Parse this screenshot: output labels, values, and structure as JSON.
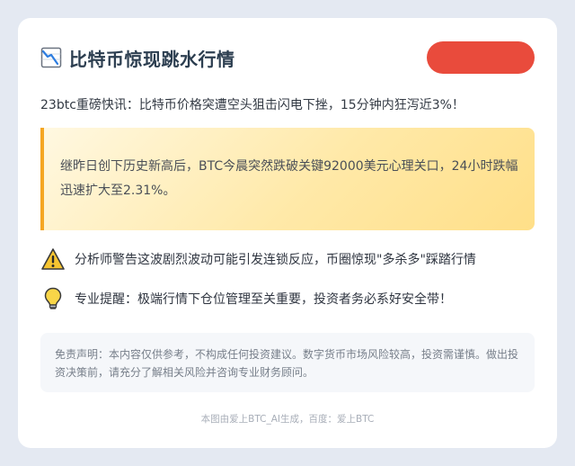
{
  "header": {
    "title": "比特币惊现跳水行情",
    "title_icon": "chart-down-icon",
    "badge_color": "#e94b3c"
  },
  "subtitle": "23btc重磅快讯：比特币价格突遭空头狙击闪电下挫，15分钟内狂泻近3%！",
  "highlight": {
    "text": "继昨日创下历史新高后，BTC今晨突然跌破关键92000美元心理关口，24小时跌幅迅速扩大至2.31%。",
    "accent_color": "#f5a623"
  },
  "notes": [
    {
      "icon": "warning-icon",
      "text": "分析师警告这波剧烈波动可能引发连锁反应，币圈惊现\"多杀多\"踩踏行情"
    },
    {
      "icon": "lightbulb-icon",
      "text": "专业提醒：极端行情下仓位管理至关重要，投资者务必系好安全带！"
    }
  ],
  "disclaimer": "免责声明：本内容仅供参考，不构成任何投资建议。数字货币市场风险较高，投资需谨慎。做出投资决策前，请充分了解相关风险并咨询专业财务顾问。",
  "footer": "本图由爱上BTC_AI生成，百度：爱上BTC"
}
